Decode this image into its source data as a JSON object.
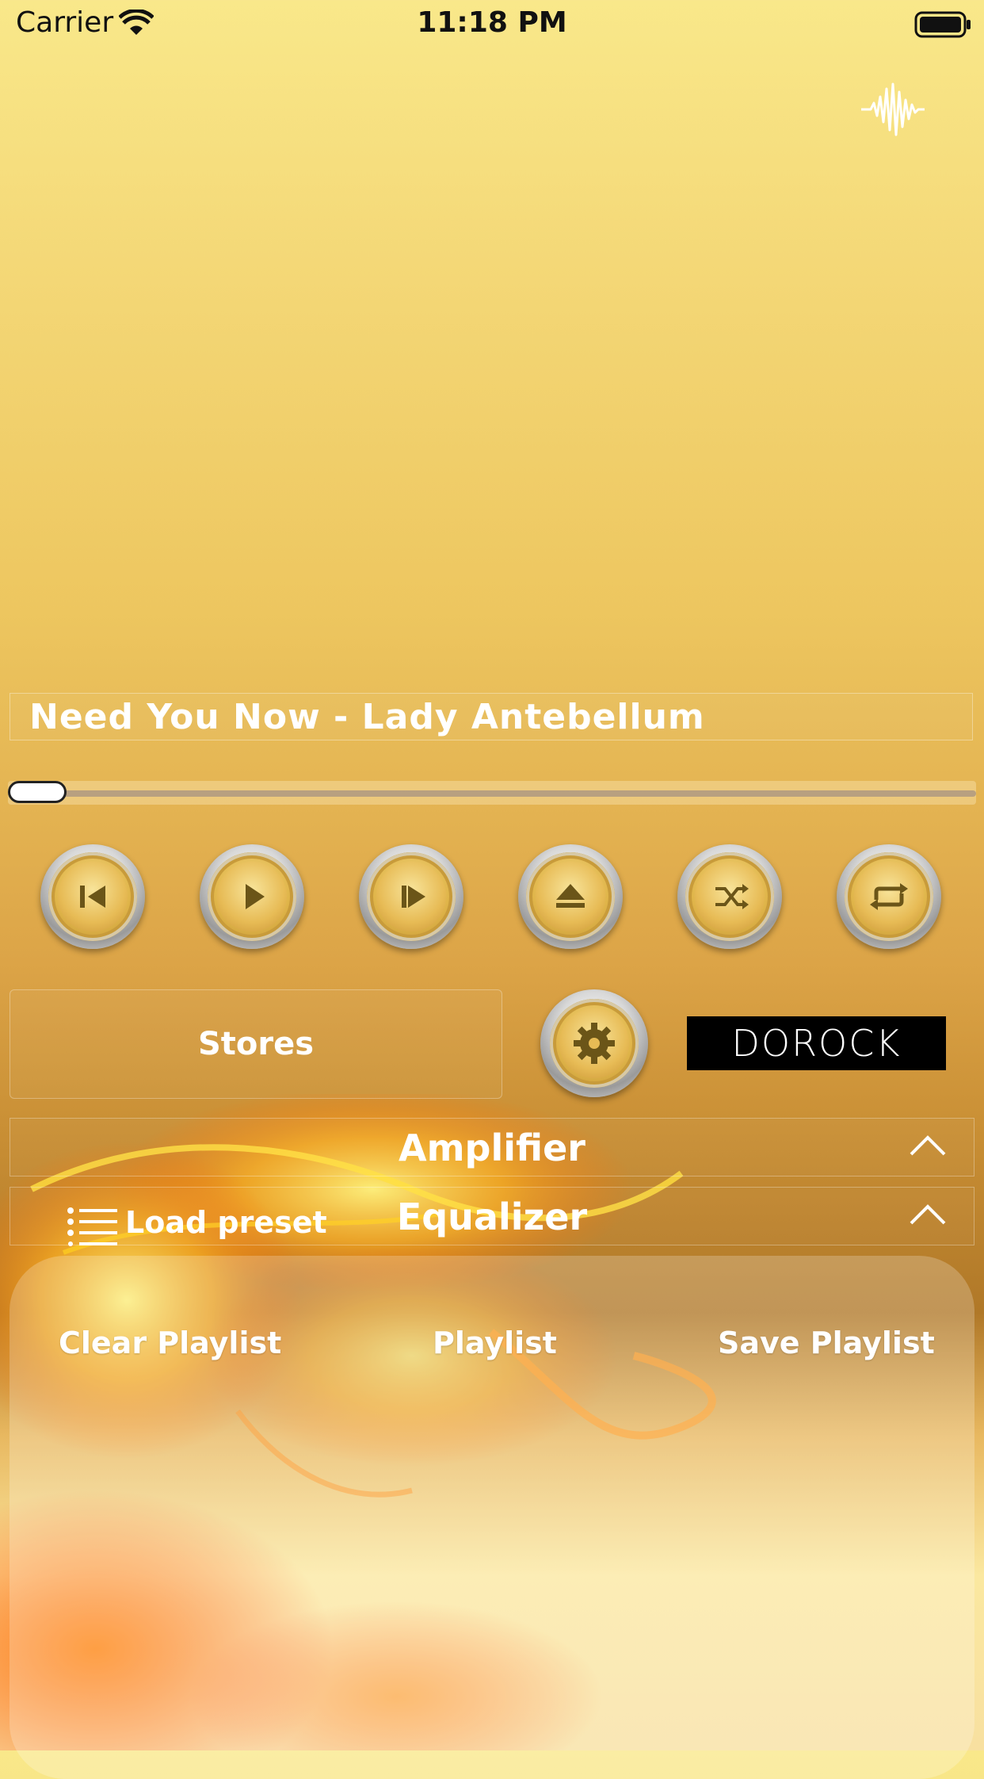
{
  "status_bar": {
    "carrier": "Carrier",
    "time": "11:18 PM"
  },
  "track": {
    "title": "Need You Now - Lady Antebellum",
    "progress_fraction": 0.0
  },
  "controls": [
    {
      "name": "previous-button",
      "icon": "skip-back-icon"
    },
    {
      "name": "play-button",
      "icon": "play-icon"
    },
    {
      "name": "next-button",
      "icon": "skip-forward-icon"
    },
    {
      "name": "eject-button",
      "icon": "eject-icon"
    },
    {
      "name": "shuffle-button",
      "icon": "shuffle-icon"
    },
    {
      "name": "repeat-button",
      "icon": "repeat-icon"
    }
  ],
  "stores": {
    "label": "Stores"
  },
  "logo": {
    "text": "DOROCK"
  },
  "amplifier": {
    "label": "Amplifier"
  },
  "equalizer": {
    "label": "Equalizer"
  },
  "load_preset": {
    "label": "Load preset"
  },
  "playlist": {
    "clear_label": "Clear Playlist",
    "title": "Playlist",
    "save_label": "Save Playlist"
  },
  "colors": {
    "gold": "#e0b54a",
    "text": "#ffffff",
    "logo_bg": "#000000"
  }
}
